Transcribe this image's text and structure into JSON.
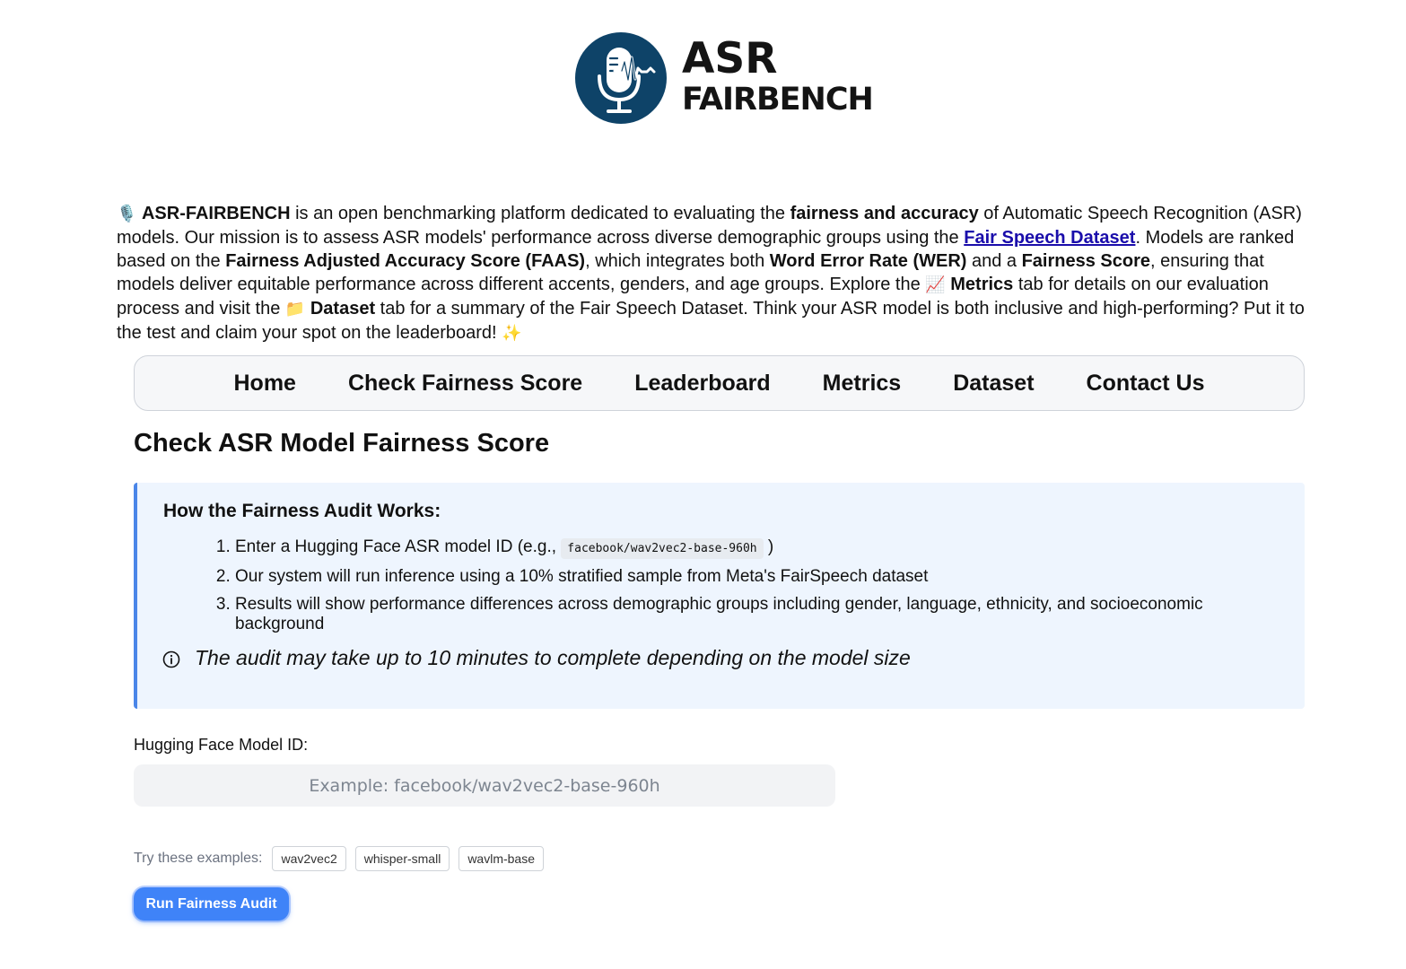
{
  "logo": {
    "line1": "ASR",
    "line2": "FAIRBENCH",
    "icon": "microphone-icon",
    "color": "#0e4368"
  },
  "intro": {
    "emoji_mic": "🎙️",
    "brand": "ASR-FAIRBENCH",
    "t1": " is an open benchmarking platform dedicated to evaluating the ",
    "b1": "fairness and accuracy",
    "t2": " of Automatic Speech Recognition (ASR) models. Our mission is to assess ASR models' performance across diverse demographic groups using the ",
    "link": "Fair Speech Dataset",
    "t3": ". Models are ranked based on the ",
    "b2": "Fairness Adjusted Accuracy Score (FAAS)",
    "t4": ", which integrates both ",
    "b3": "Word Error Rate (WER)",
    "t5": " and a ",
    "b4": "Fairness Score",
    "t6": ", ensuring that models deliver equitable performance across different accents, genders, and age groups. Explore the ",
    "emoji_chart": "📈",
    "b5": "Metrics",
    "t7": " tab for details on our evaluation process and visit the ",
    "emoji_folder": "📁",
    "b6": "Dataset",
    "t8": " tab for a summary of the Fair Speech Dataset. Think your ASR model is both inclusive and high-performing? Put it to the test and claim your spot on the leaderboard! ",
    "emoji_sparkle": "✨"
  },
  "nav": {
    "items": [
      "Home",
      "Check Fairness Score",
      "Leaderboard",
      "Metrics",
      "Dataset",
      "Contact Us"
    ]
  },
  "section": {
    "title": "Check ASR Model Fairness Score"
  },
  "info": {
    "title": "How the Fairness Audit Works:",
    "step1_text": "Enter a Hugging Face ASR model ID (e.g., ",
    "step1_code": "facebook/wav2vec2-base-960h",
    "step1_end": ")",
    "step2": "Our system will run inference using a 10% stratified sample from Meta's FairSpeech dataset",
    "step3": "Results will show performance differences across demographic groups including gender, language, ethnicity, and socioeconomic background",
    "note": "The audit may take up to 10 minutes to complete depending on the model size",
    "accent": "#4a86e8"
  },
  "form": {
    "label": "Hugging Face Model ID:",
    "value": "",
    "placeholder": "Example: facebook/wav2vec2-base-960h",
    "examples_label": "Try these examples:",
    "examples": [
      "wav2vec2",
      "whisper-small",
      "wavlm-base"
    ],
    "submit": "Run Fairness Audit",
    "button_color": "#3f83f8"
  }
}
